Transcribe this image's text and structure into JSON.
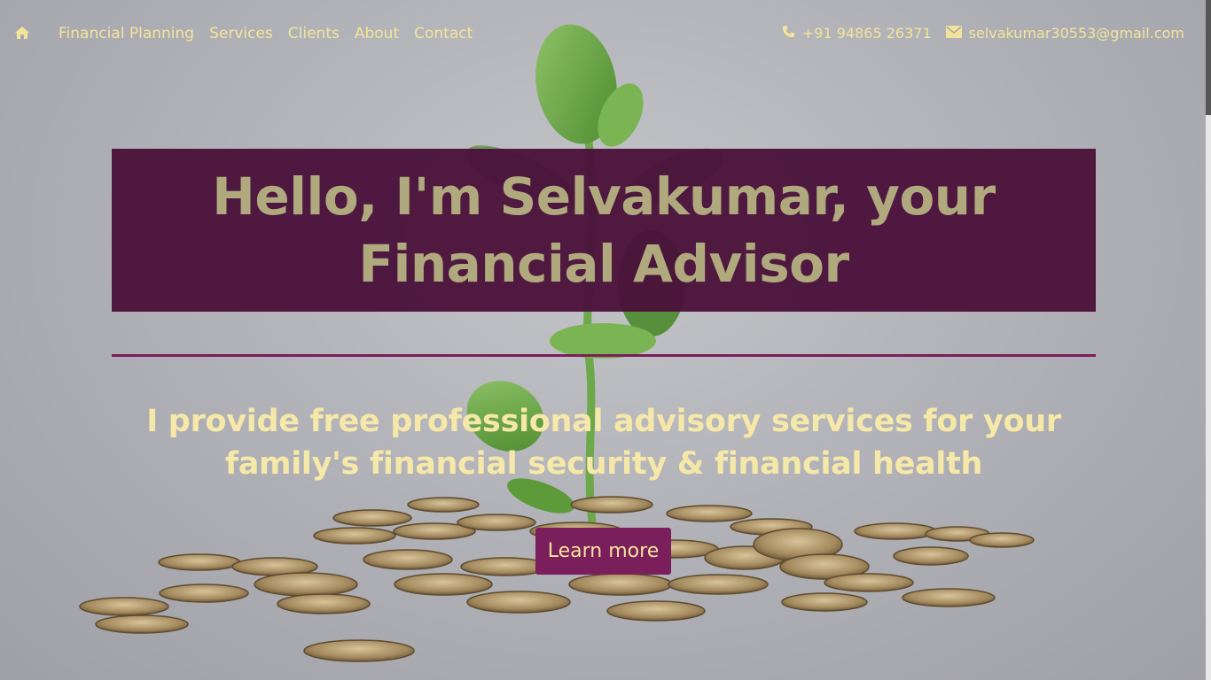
{
  "nav": {
    "home_icon": "home-icon",
    "links": [
      "Financial Planning",
      "Services",
      "Clients",
      "About",
      "Contact"
    ],
    "phone": "+91 94865 26371",
    "email": "selvakumar30553@gmail.com",
    "phone_icon": "phone-icon",
    "email_icon": "envelope-icon"
  },
  "hero": {
    "title": "Hello, I'm Selvakumar, your Financial Advisor",
    "tagline": "I provide free professional advisory services for your family's financial security & financial health",
    "cta_label": "Learn more"
  },
  "colors": {
    "accent_text": "#f3e49c",
    "title_box": "#4a123a",
    "brand": "#7a1f5c"
  }
}
